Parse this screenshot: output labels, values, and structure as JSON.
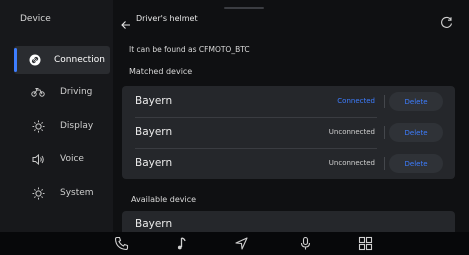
{
  "sidebar": {
    "title": "Device",
    "items": [
      {
        "label": "Connection",
        "icon": "connection-icon",
        "active": true
      },
      {
        "label": "Driving",
        "icon": "motorcycle-icon",
        "active": false
      },
      {
        "label": "Display",
        "icon": "brightness-icon",
        "active": false
      },
      {
        "label": "Voice",
        "icon": "speaker-icon",
        "active": false
      },
      {
        "label": "System",
        "icon": "system-icon",
        "active": false
      }
    ]
  },
  "header": {
    "title": "Driver's helmet",
    "back_icon": "back-arrow-icon",
    "refresh_icon": "refresh-icon"
  },
  "main": {
    "found_text": "It can be found as CFMOTO_BTC",
    "matched_title": "Matched device",
    "matched_devices": [
      {
        "name": "Bayern",
        "status": "Connected",
        "action": "Delete"
      },
      {
        "name": "Bayern",
        "status": "Unconnected",
        "action": "Delete"
      },
      {
        "name": "Bayern",
        "status": "Unconnected",
        "action": "Delete"
      }
    ],
    "available_title": "Available device",
    "available_devices": [
      {
        "name": "Bayern"
      }
    ]
  },
  "bottom_bar": {
    "icons": [
      "phone-icon",
      "music-icon",
      "navigation-icon",
      "microphone-icon",
      "apps-grid-icon"
    ]
  },
  "colors": {
    "accent": "#3d7dff",
    "sidebar_bg": "#17181b",
    "main_bg": "#0f1012",
    "card_bg": "#25272b"
  }
}
